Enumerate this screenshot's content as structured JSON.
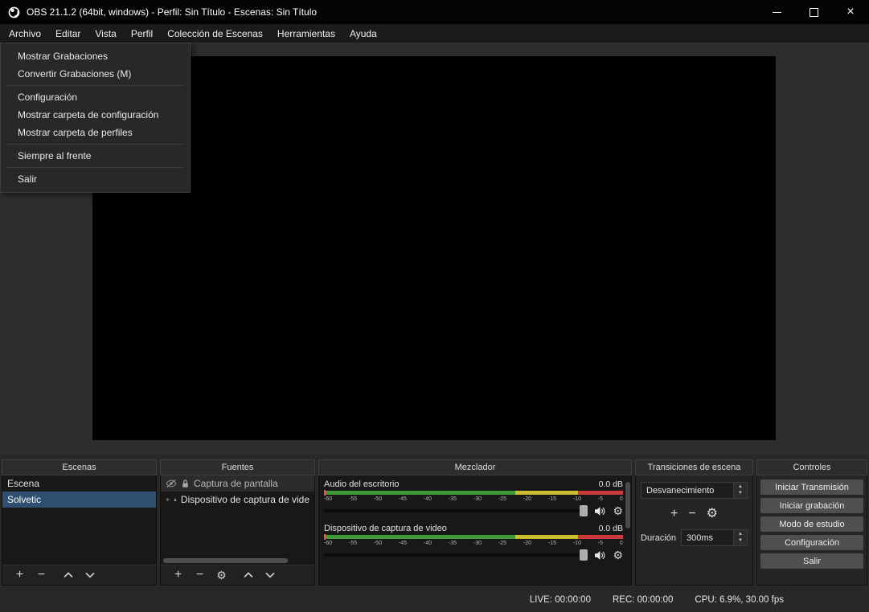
{
  "window": {
    "title": "OBS 21.1.2 (64bit, windows) - Perfil: Sin Título - Escenas: Sin Título"
  },
  "menubar": {
    "items": [
      "Archivo",
      "Editar",
      "Vista",
      "Perfil",
      "Colección de Escenas",
      "Herramientas",
      "Ayuda"
    ]
  },
  "file_menu": {
    "items": [
      "Mostrar Grabaciones",
      "Convertir Grabaciones (M)",
      "Configuración",
      "Mostrar carpeta de configuración",
      "Mostrar carpeta de perfiles",
      "Siempre al frente",
      "Salir"
    ]
  },
  "scenes": {
    "title": "Escenas",
    "items": [
      "Escena",
      "Solvetic"
    ],
    "selected": "Solvetic"
  },
  "sources": {
    "title": "Fuentes",
    "items": [
      {
        "label": "Captura de pantalla",
        "visible": false,
        "locked": true
      },
      {
        "label": "Dispositivo de captura de vide",
        "visible": true,
        "locked": true
      }
    ]
  },
  "mixer": {
    "title": "Mezclador",
    "channels": [
      {
        "name": "Audio del escritorio",
        "level": "0.0 dB"
      },
      {
        "name": "Dispositivo de captura de video",
        "level": "0.0 dB"
      }
    ],
    "scale": [
      "-60",
      "-55",
      "-50",
      "-45",
      "-40",
      "-35",
      "-30",
      "-25",
      "-20",
      "-15",
      "-10",
      "-5",
      "0"
    ]
  },
  "transitions": {
    "title": "Transiciones de escena",
    "selected": "Desvanecimiento",
    "duration_label": "Duración",
    "duration_value": "300ms"
  },
  "controls": {
    "title": "Controles",
    "buttons": [
      "Iniciar Transmisión",
      "Iniciar grabación",
      "Modo de estudio",
      "Configuración",
      "Salir"
    ]
  },
  "statusbar": {
    "live": "LIVE: 00:00:00",
    "rec": "REC: 00:00:00",
    "cpu": "CPU: 6.9%, 30.00 fps"
  },
  "icons": {
    "close": "×",
    "gear": "⚙",
    "plus": "+",
    "minus": "−",
    "arrow_up": "▲",
    "arrow_down": "▼"
  },
  "colors": {
    "selection": "#2e4f70",
    "meter_green": "#3f9b37",
    "meter_yellow": "#cdbd2e",
    "meter_red": "#cc3b3b"
  }
}
